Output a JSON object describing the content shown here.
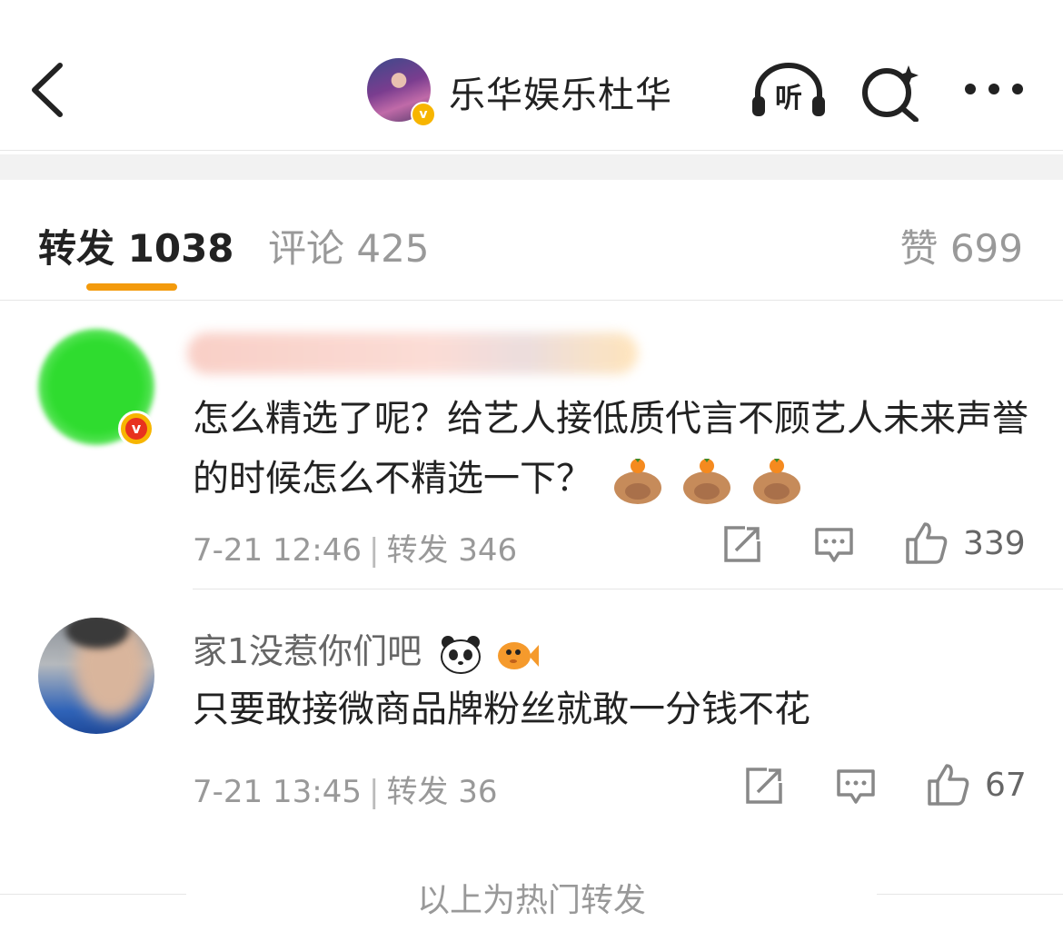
{
  "header": {
    "title": "乐华娱乐杜华",
    "verified_mark": "v",
    "listen_icon_text": "听",
    "back_icon": "chevron-left-icon",
    "search_icon": "search-sparkle-icon",
    "more_icon": "more-dots-icon"
  },
  "tabs": {
    "repost": "转发 1038",
    "comment": "评论 425",
    "like": "赞 699",
    "active": "repost",
    "accent": "#f39a0c"
  },
  "reposts": [
    {
      "name": "",
      "content": "怎么精选了呢？给艺人接低质代言不顾艺人未来声誉的时候怎么不精选一下？",
      "emoji_count": 3,
      "time": "7-21 12:46",
      "repost_label": "转发 346",
      "likes": "339"
    },
    {
      "name": "家1没惹你们吧",
      "content": "只要敢接微商品牌粉丝就敢一分钱不花",
      "time": "7-21 13:45",
      "repost_label": "转发 36",
      "likes": "67"
    }
  ],
  "footer": {
    "text": "以上为热门转发"
  },
  "colors": {
    "text_primary": "#222222",
    "text_secondary": "#999999",
    "verified_orange": "#f7b500",
    "verified_red": "#e8321e"
  }
}
